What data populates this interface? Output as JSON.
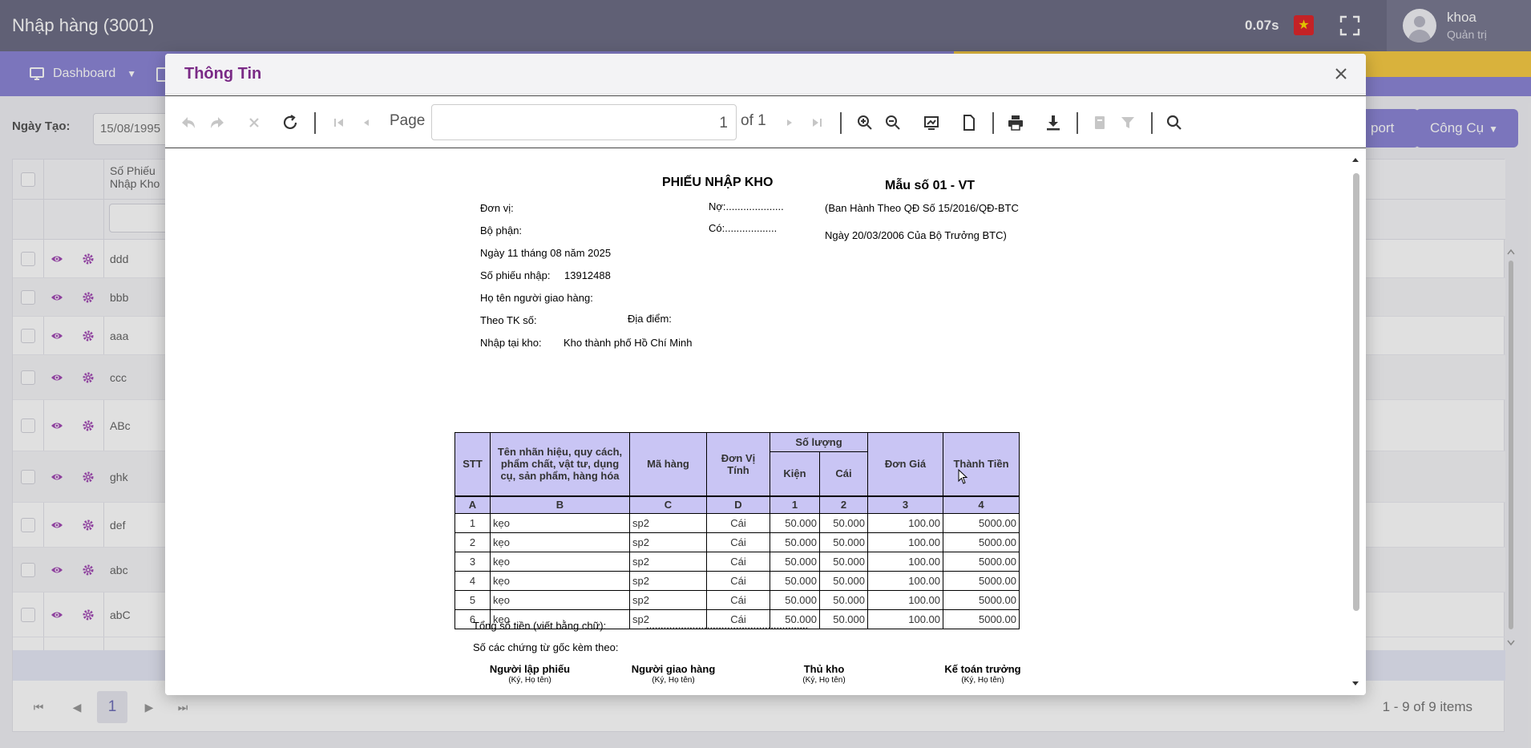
{
  "app": {
    "title": "Nhập hàng (3001)",
    "timing": "0.07s",
    "user_name": "khoa",
    "user_role": "Quản trị"
  },
  "nav": {
    "dashboard_label": "Dashboard"
  },
  "filter": {
    "date_label": "Ngày Tạo:",
    "date_value": "15/08/1995",
    "report_label": "port",
    "tools_label": "Công Cụ"
  },
  "grid": {
    "header_label": "Số Phiếu Nhập Kho",
    "rows": [
      "ddd",
      "bbb",
      "aaa",
      "ccc",
      "ABc",
      "ghk",
      "def",
      "abc",
      "abC"
    ],
    "pager": {
      "current_page": "1",
      "info": "1 - 9 of 9 items"
    }
  },
  "modal": {
    "title": "Thông Tin",
    "toolbar": {
      "page_label": "Page",
      "page_value": "1",
      "of_label": "of 1"
    }
  },
  "report": {
    "title": "PHIẾU NHẬP KHO",
    "form_no": "Mẫu số 01 - VT",
    "don_vi": "Đơn vị:",
    "bo_phan": "Bộ phận:",
    "no": "Nợ:....................",
    "co": "Có:..................",
    "circular1": "(Ban Hành Theo QĐ Số 15/2016/QĐ-BTC",
    "circular2": "Ngày 20/03/2006 Của Bộ Trưởng BTC)",
    "date_line": "Ngày  11  tháng  08  năm  2025",
    "receipt_label": "Số phiếu nhập:",
    "receipt_no": "13912488",
    "deliverer": "Họ tên người giao hàng:",
    "theo_tk": "Theo TK số:",
    "dia_diem": "Địa điểm:",
    "warehouse_label": "Nhập tại kho:",
    "warehouse_name": "Kho thành phố Hồ Chí Minh",
    "table": {
      "h_stt": "STT",
      "h_name": "Tên nhãn hiệu, quy cách, phẩm chất, vật tư, dụng cụ, sản phẩm, hàng hóa",
      "h_code": "Mã hàng",
      "h_unit": "Đơn Vị Tính",
      "h_qty": "Số lượng",
      "h_kien": "Kiện",
      "h_cai": "Cái",
      "h_price": "Đơn Giá",
      "h_total": "Thành Tiền",
      "idx": [
        "A",
        "B",
        "C",
        "D",
        "1",
        "2",
        "3",
        "4"
      ],
      "rows": [
        {
          "stt": "1",
          "name": "kẹo",
          "code": "sp2",
          "unit": "Cái",
          "kien": "50.000",
          "cai": "50.000",
          "price": "100.00",
          "total": "5000.00"
        },
        {
          "stt": "2",
          "name": "kẹo",
          "code": "sp2",
          "unit": "Cái",
          "kien": "50.000",
          "cai": "50.000",
          "price": "100.00",
          "total": "5000.00"
        },
        {
          "stt": "3",
          "name": "kẹo",
          "code": "sp2",
          "unit": "Cái",
          "kien": "50.000",
          "cai": "50.000",
          "price": "100.00",
          "total": "5000.00"
        },
        {
          "stt": "4",
          "name": "kẹo",
          "code": "sp2",
          "unit": "Cái",
          "kien": "50.000",
          "cai": "50.000",
          "price": "100.00",
          "total": "5000.00"
        },
        {
          "stt": "5",
          "name": "kẹo",
          "code": "sp2",
          "unit": "Cái",
          "kien": "50.000",
          "cai": "50.000",
          "price": "100.00",
          "total": "5000.00"
        },
        {
          "stt": "6",
          "name": "kẹo",
          "code": "sp2",
          "unit": "Cái",
          "kien": "50.000",
          "cai": "50.000",
          "price": "100.00",
          "total": "5000.00"
        }
      ]
    },
    "total_words_label": "Tổng số tiền (viết bằng chữ):",
    "total_words_dots": "........................................................",
    "attached_docs": "Số các chứng từ gốc kèm theo:",
    "signatures": [
      {
        "role": "Người lập phiếu",
        "note": "(Ký, Họ tên)"
      },
      {
        "role": "Người giao hàng",
        "note": "(Ký, Họ tên)"
      },
      {
        "role": "Thủ kho",
        "note": "(Ký, Họ tên)"
      },
      {
        "role": "Kế toán trưởng",
        "note": "(Ký, Họ tên)"
      }
    ]
  }
}
